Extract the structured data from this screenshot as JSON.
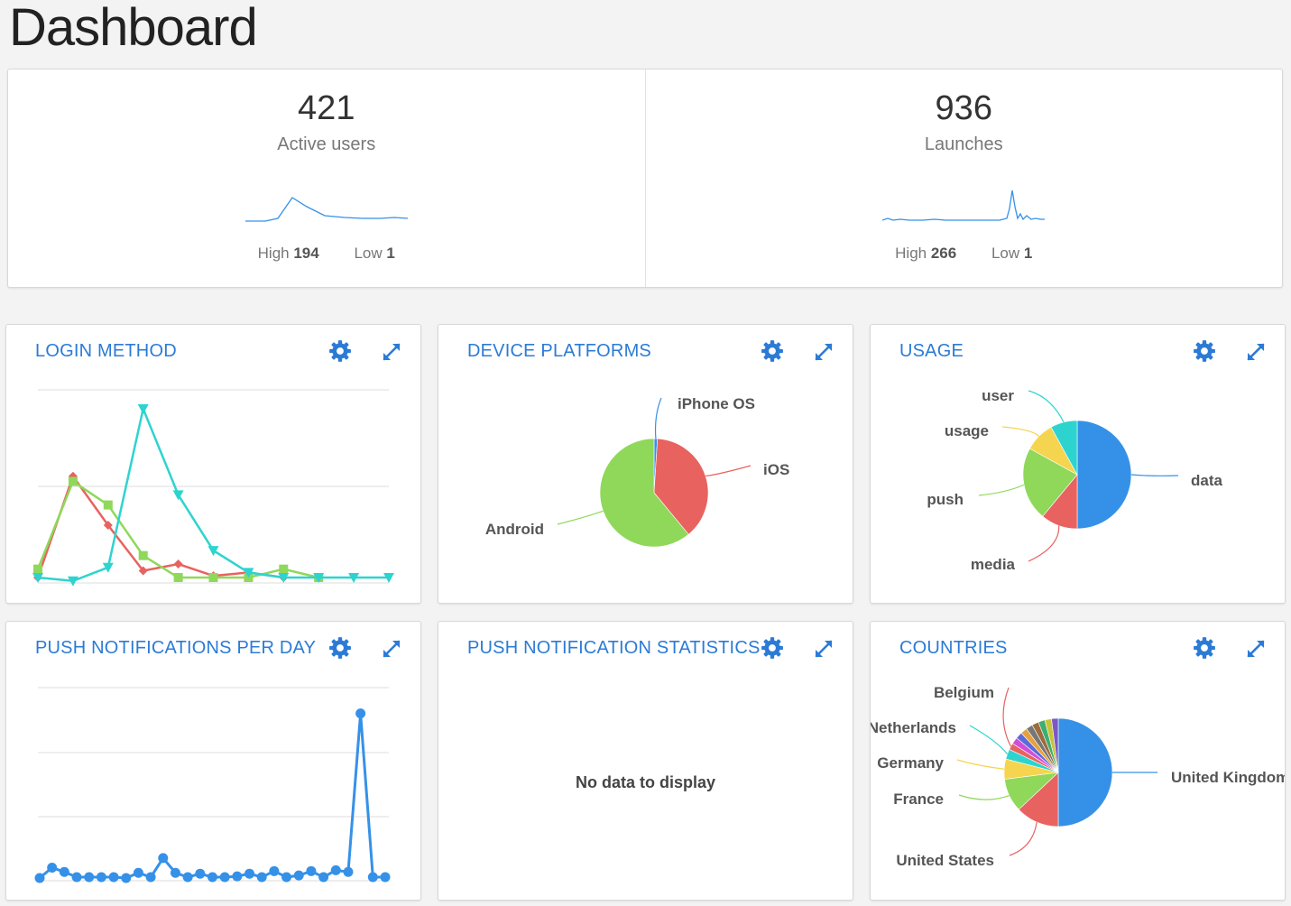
{
  "page": {
    "title": "Dashboard"
  },
  "stats": [
    {
      "value": "421",
      "label": "Active users",
      "high_label": "High",
      "high": "194",
      "low_label": "Low",
      "low": "1"
    },
    {
      "value": "936",
      "label": "Launches",
      "high_label": "High",
      "high": "266",
      "low_label": "Low",
      "low": "1"
    }
  ],
  "panels": {
    "login_method": {
      "title": "LOGIN METHOD"
    },
    "device_platforms": {
      "title": "DEVICE PLATFORMS"
    },
    "usage": {
      "title": "USAGE"
    },
    "push_per_day": {
      "title": "PUSH NOTIFICATIONS PER DAY"
    },
    "push_stats": {
      "title": "PUSH NOTIFICATION STATISTICS",
      "empty_text": "No data to display"
    },
    "countries": {
      "title": "COUNTRIES"
    }
  },
  "icons": {
    "settings": "gear-icon",
    "expand": "expand-icon"
  },
  "colors": {
    "accent": "#2b7bd6",
    "red": "#e8625f",
    "green": "#8fd85a",
    "cyan": "#2dd4cf",
    "yellow": "#f5d54f",
    "blue": "#3591e8"
  },
  "chart_data": [
    {
      "chart": "login_method",
      "type": "line",
      "x": [
        0,
        1,
        2,
        3,
        4,
        5,
        6,
        7,
        8,
        9,
        10
      ],
      "series": [
        {
          "color": "#e8625f",
          "marker": "diamond",
          "values": [
            0,
            60,
            31,
            4,
            8,
            1,
            3,
            0,
            null,
            null,
            null
          ]
        },
        {
          "color": "#8fd85a",
          "marker": "square",
          "values": [
            5,
            57,
            43,
            13,
            0,
            0,
            0,
            5,
            0,
            null,
            null
          ]
        },
        {
          "color": "#2dd4cf",
          "marker": "triangle",
          "values": [
            0,
            -2,
            6,
            100,
            49,
            16,
            3,
            0,
            0,
            0,
            0
          ]
        }
      ],
      "ylim": [
        0,
        100
      ]
    },
    {
      "chart": "device_platforms",
      "type": "pie",
      "slices": [
        {
          "label": "iPhone OS",
          "value": 1,
          "color": "#3591e8"
        },
        {
          "label": "iOS",
          "value": 38,
          "color": "#e8625f"
        },
        {
          "label": "Android",
          "value": 61,
          "color": "#8fd85a"
        }
      ]
    },
    {
      "chart": "usage",
      "type": "pie",
      "slices": [
        {
          "label": "data",
          "value": 50,
          "color": "#3591e8"
        },
        {
          "label": "media",
          "value": 11,
          "color": "#e8625f"
        },
        {
          "label": "push",
          "value": 22,
          "color": "#8fd85a"
        },
        {
          "label": "usage",
          "value": 9,
          "color": "#f5d54f"
        },
        {
          "label": "user",
          "value": 8,
          "color": "#2dd4cf"
        }
      ]
    },
    {
      "chart": "push_per_day",
      "type": "line",
      "color": "#3591e8",
      "values": [
        0,
        12,
        7,
        1,
        1,
        1,
        1,
        0,
        6,
        1,
        23,
        6,
        1,
        5,
        1,
        1,
        2,
        5,
        1,
        8,
        1,
        3,
        8,
        1,
        9,
        7,
        190,
        1,
        1
      ],
      "ylim": [
        0,
        200
      ]
    },
    {
      "chart": "countries",
      "type": "pie",
      "slices": [
        {
          "label": "United Kingdom",
          "value": 50,
          "color": "#3591e8"
        },
        {
          "label": "United States",
          "value": 13,
          "color": "#e8625f"
        },
        {
          "label": "France",
          "value": 10,
          "color": "#8fd85a"
        },
        {
          "label": "Germany",
          "value": 6,
          "color": "#f5d54f"
        },
        {
          "label": "Netherlands",
          "value": 3,
          "color": "#2dd4cf"
        },
        {
          "label": "Belgium",
          "value": 2,
          "color": "#e8625f"
        },
        {
          "label": "",
          "value": 2,
          "color": "#d04fd8"
        },
        {
          "label": "",
          "value": 2,
          "color": "#5b6bd8"
        },
        {
          "label": "",
          "value": 2,
          "color": "#e8a13a"
        },
        {
          "label": "",
          "value": 2,
          "color": "#777777"
        },
        {
          "label": "",
          "value": 2,
          "color": "#9d6b3c"
        },
        {
          "label": "",
          "value": 2,
          "color": "#3fae6f"
        },
        {
          "label": "",
          "value": 2,
          "color": "#c8c43a"
        },
        {
          "label": "",
          "value": 2,
          "color": "#7e57c2"
        }
      ]
    }
  ]
}
